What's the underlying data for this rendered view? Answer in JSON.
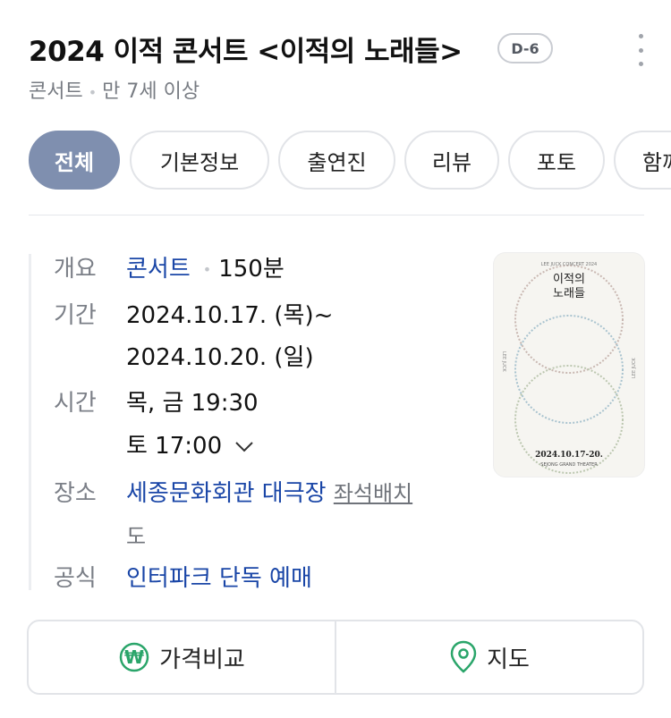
{
  "header": {
    "title": "2024 이적 콘서트 <이적의 노래들>",
    "dday": "D-6",
    "genre": "콘서트",
    "age": "만 7세 이상"
  },
  "tabs": [
    {
      "label": "전체",
      "active": true
    },
    {
      "label": "기본정보",
      "active": false
    },
    {
      "label": "출연진",
      "active": false
    },
    {
      "label": "리뷰",
      "active": false
    },
    {
      "label": "포토",
      "active": false
    },
    {
      "label": "함께",
      "active": false
    }
  ],
  "info": {
    "overview_label": "개요",
    "overview_genre": "콘서트",
    "overview_duration": "150분",
    "period_label": "기간",
    "period_start": "2024.10.17. (목)~",
    "period_end": "2024.10.20. (일)",
    "time_label": "시간",
    "time_weekday": "목, 금 19:30",
    "time_saturday": "토 17:00",
    "venue_label": "장소",
    "venue_name": "세종문화회관 대극장",
    "venue_seat_link_1": "좌석배치",
    "venue_seat_link_2": "도",
    "official_label": "공식",
    "official_link": "인터파크 단독 예매"
  },
  "poster": {
    "title_line1": "이적의",
    "title_line2": "노래들",
    "small_top": "LEE JUCK CONCERT 2024",
    "side_left": "LEE JUCK",
    "side_right": "LEE JUCK",
    "date_text": "2024.10.17-20.",
    "venue_text": "SEJONG GRAND THEATER"
  },
  "actions": {
    "price_compare": "가격비교",
    "map": "지도"
  },
  "icons": {
    "won": "won-circle-icon",
    "map_pin": "map-pin-icon",
    "chevron": "chevron-down-icon",
    "more": "more-vertical-icon"
  },
  "colors": {
    "active_tab": "#7f8faf",
    "link": "#1a46a7",
    "accent_green": "#2aa56a"
  }
}
